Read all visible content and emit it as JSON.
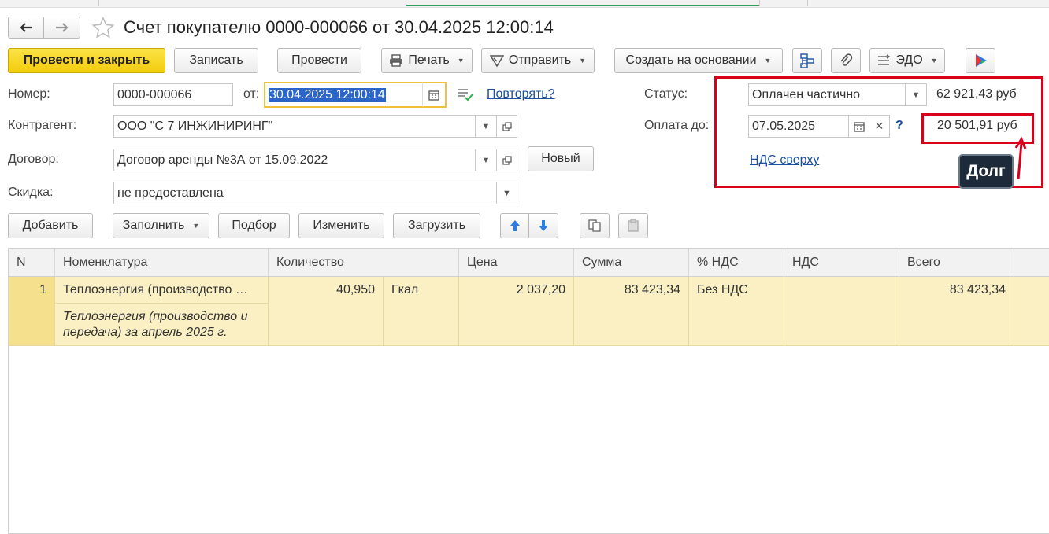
{
  "title": "Счет покупателю 0000-000066 от 30.04.2025 12:00:14",
  "toolbar": {
    "post_close": "Провести и закрыть",
    "save": "Записать",
    "post": "Провести",
    "print": "Печать",
    "send": "Отправить",
    "create_based": "Создать на основании",
    "edo": "ЭДО"
  },
  "form": {
    "number_label": "Номер:",
    "number_value": "0000-000066",
    "from_label": "от:",
    "date_value": "30.04.2025 12:00:14",
    "repeat_link": "Повторять?",
    "counterparty_label": "Контрагент:",
    "counterparty_value": "ООО \"С 7 ИНЖИНИРИНГ\"",
    "contract_label": "Договор:",
    "contract_value": "Договор аренды №3А от 15.09.2022",
    "new_button": "Новый",
    "discount_label": "Скидка:",
    "discount_value": "не предоставлена",
    "status_label": "Статус:",
    "status_value": "Оплачен частично",
    "status_amount": "62 921,43 руб",
    "pay_until_label": "Оплата до:",
    "pay_until_value": "07.05.2025",
    "help": "?",
    "debt_amount": "20 501,91 руб",
    "vat_link": "НДС сверху",
    "debt_tooltip": "Долг"
  },
  "table_toolbar": {
    "add": "Добавить",
    "fill": "Заполнить",
    "select": "Подбор",
    "change": "Изменить",
    "load": "Загрузить"
  },
  "table": {
    "headers": [
      "N",
      "Номенклатура",
      "Количество",
      "Цена",
      "Сумма",
      "% НДС",
      "НДС",
      "Всего"
    ],
    "rows": [
      {
        "n": "1",
        "item": "Теплоэнергия (производство …",
        "item_desc_line1": "Теплоэнергия (производство и",
        "item_desc_line2": "передача) за апрель 2025 г.",
        "qty": "40,950",
        "unit": "Гкал",
        "price": "2 037,20",
        "sum": "83 423,34",
        "vat_rate": "Без НДС",
        "vat": "",
        "total": "83 423,34"
      }
    ]
  },
  "colors": {
    "primary_yellow": "#f5d119",
    "row_highlight": "#fbf0c4",
    "annotation_red": "#d9001b",
    "link_blue": "#1a4f9e"
  }
}
